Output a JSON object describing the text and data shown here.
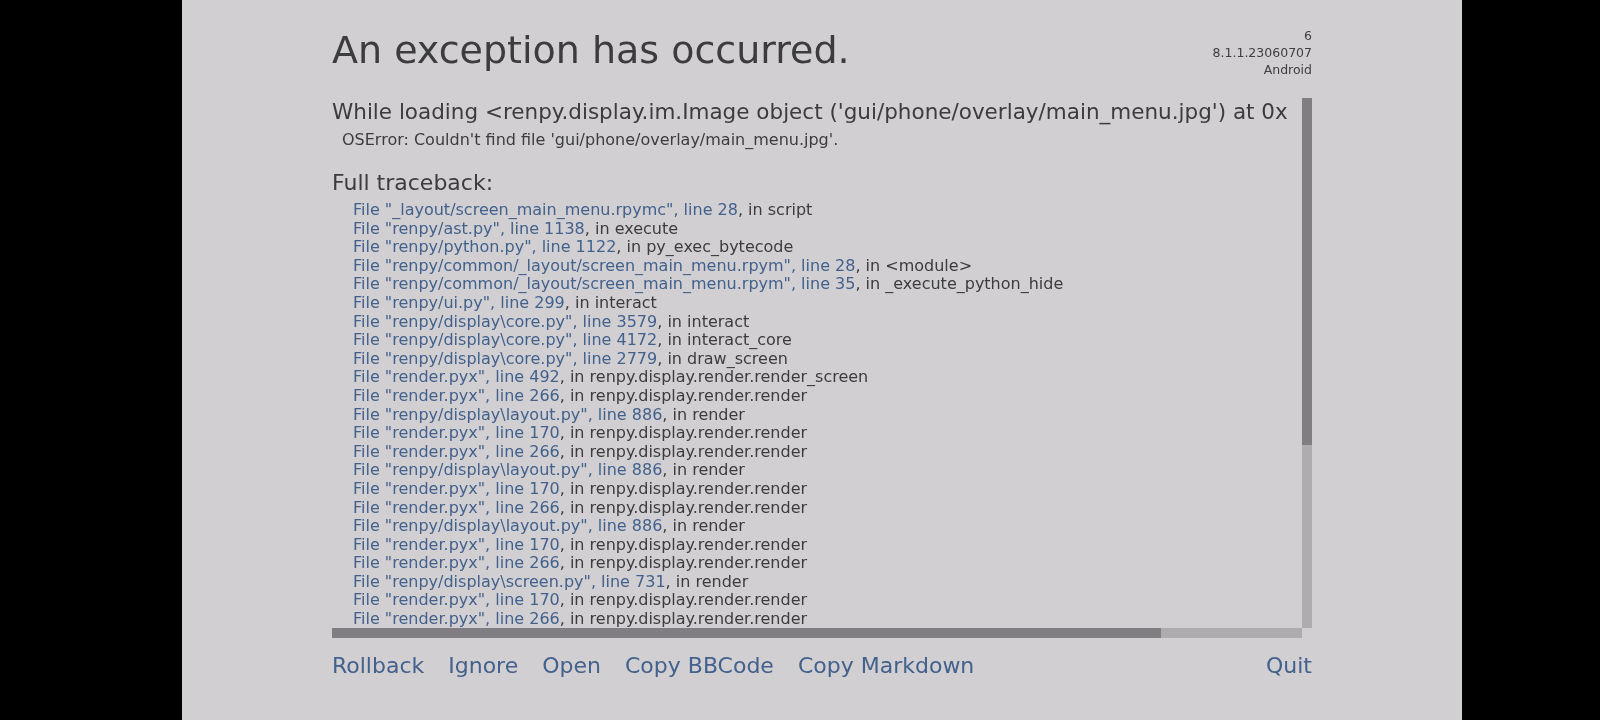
{
  "window": {
    "title": "An exception has occurred."
  },
  "version_info": [
    "6",
    "8.1.1.23060707",
    "Android"
  ],
  "exception": {
    "message": "While loading <renpy.display.im.Image object ('gui/phone/overlay/main_menu.jpg') at 0x",
    "detail": "OSError: Couldn't find file 'gui/phone/overlay/main_menu.jpg'."
  },
  "traceback": {
    "heading": "Full traceback:",
    "frames": [
      {
        "location": "File \"_layout/screen_main_menu.rpymc\", line 28",
        "context": ", in script"
      },
      {
        "location": "File \"renpy/ast.py\", line 1138",
        "context": ", in execute"
      },
      {
        "location": "File \"renpy/python.py\", line 1122",
        "context": ", in py_exec_bytecode"
      },
      {
        "location": "File \"renpy/common/_layout/screen_main_menu.rpym\", line 28",
        "context": ", in <module>"
      },
      {
        "location": "File \"renpy/common/_layout/screen_main_menu.rpym\", line 35",
        "context": ", in _execute_python_hide"
      },
      {
        "location": "File \"renpy/ui.py\", line 299",
        "context": ", in interact"
      },
      {
        "location": "File \"renpy/display\\core.py\", line 3579",
        "context": ", in interact"
      },
      {
        "location": "File \"renpy/display\\core.py\", line 4172",
        "context": ", in interact_core"
      },
      {
        "location": "File \"renpy/display\\core.py\", line 2779",
        "context": ", in draw_screen"
      },
      {
        "location": "File \"render.pyx\", line 492",
        "context": ", in renpy.display.render.render_screen"
      },
      {
        "location": "File \"render.pyx\", line 266",
        "context": ", in renpy.display.render.render"
      },
      {
        "location": "File \"renpy/display\\layout.py\", line 886",
        "context": ", in render"
      },
      {
        "location": "File \"render.pyx\", line 170",
        "context": ", in renpy.display.render.render"
      },
      {
        "location": "File \"render.pyx\", line 266",
        "context": ", in renpy.display.render.render"
      },
      {
        "location": "File \"renpy/display\\layout.py\", line 886",
        "context": ", in render"
      },
      {
        "location": "File \"render.pyx\", line 170",
        "context": ", in renpy.display.render.render"
      },
      {
        "location": "File \"render.pyx\", line 266",
        "context": ", in renpy.display.render.render"
      },
      {
        "location": "File \"renpy/display\\layout.py\", line 886",
        "context": ", in render"
      },
      {
        "location": "File \"render.pyx\", line 170",
        "context": ", in renpy.display.render.render"
      },
      {
        "location": "File \"render.pyx\", line 266",
        "context": ", in renpy.display.render.render"
      },
      {
        "location": "File \"renpy/display\\screen.py\", line 731",
        "context": ", in render"
      },
      {
        "location": "File \"render.pyx\", line 170",
        "context": ", in renpy.display.render.render"
      },
      {
        "location": "File \"render.pyx\", line 266",
        "context": ", in renpy.display.render.render"
      }
    ]
  },
  "buttons": {
    "left": [
      "Rollback",
      "Ignore",
      "Open",
      "Copy BBCode",
      "Copy Markdown"
    ],
    "right": [
      "Quit"
    ]
  }
}
